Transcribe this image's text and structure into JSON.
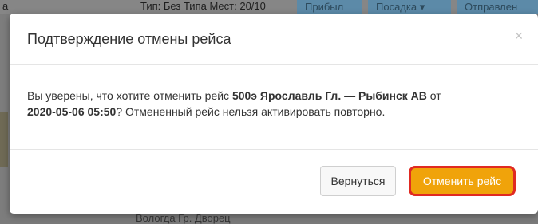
{
  "background": {
    "left_fragment": "а",
    "header_info": "Тип: Без Типа Мест: 20/10",
    "buttons": [
      "Прибыл",
      "Посадка ▾",
      "Отправлен"
    ],
    "bottom_fragment": "Вологда Гр. Дворец"
  },
  "modal": {
    "title": "Подтверждение отмены рейса",
    "close_symbol": "×",
    "body": {
      "text_1": "Вы уверены, что хотите отменить рейс ",
      "route_bold": "500э Ярославль Гл. — Рыбинск АВ",
      "text_2": " от",
      "date_bold": "2020-05-06 05:50",
      "text_3": "? Отмененный рейс нельзя активировать повторно."
    },
    "buttons": {
      "back_label": "Вернуться",
      "cancel_label": "Отменить рейс"
    }
  },
  "colors": {
    "cancel_button": "#f0a30a",
    "cancel_button_outline": "#e02a22"
  }
}
